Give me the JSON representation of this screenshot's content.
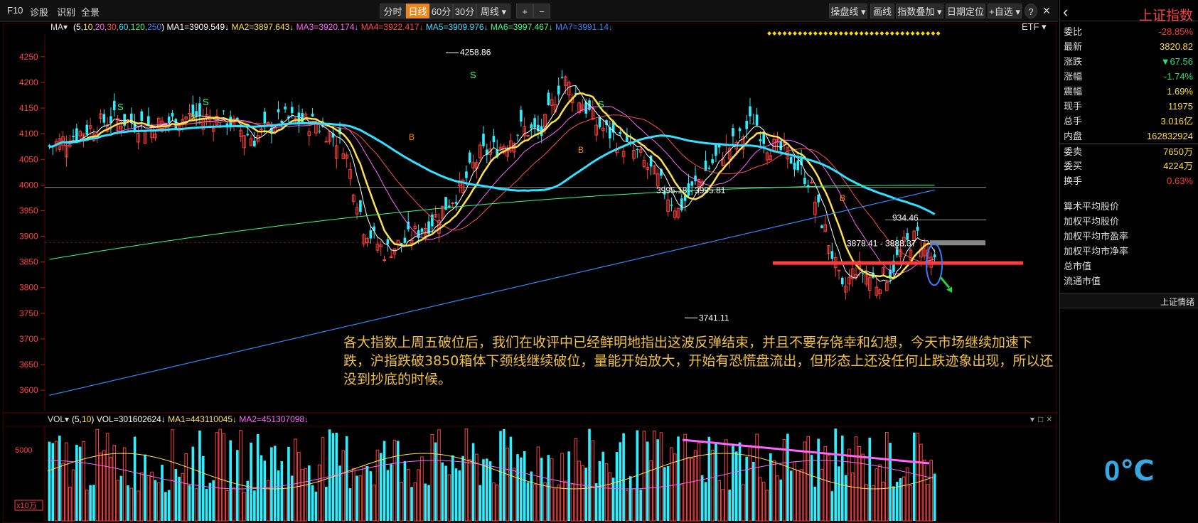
{
  "toolbar": {
    "left": [
      "F10",
      "诊股",
      "识别",
      "全景"
    ],
    "periods": [
      "分时",
      "日线",
      "60分",
      "30分",
      "周线 ▾"
    ],
    "active_period": "日线",
    "zoom": [
      "+",
      "−"
    ],
    "right": [
      "操盘线 ▾",
      "画线",
      "指数叠加 ▾",
      "日期定位",
      "+自选 ▾"
    ],
    "help": "?",
    "close": "×"
  },
  "ma_bar": {
    "label": "MA▾",
    "params_prefix": "(5,",
    "params": [
      {
        "text": "10,",
        "color": "#ffe14d"
      },
      {
        "text": "20,",
        "color": "#ff66ff"
      },
      {
        "text": "30,",
        "color": "#ff4d4d"
      },
      {
        "text": "60,",
        "color": "#33e0ff"
      },
      {
        "text": "120,",
        "color": "#33ff88"
      },
      {
        "text": "250",
        "color": "#3388ff"
      }
    ],
    "params_suffix": ")",
    "items": [
      {
        "text": "MA1=3909.549↓",
        "color": "#ffffff"
      },
      {
        "text": "MA2=3897.643↓",
        "color": "#ffe14d"
      },
      {
        "text": "MA3=3920.174↓",
        "color": "#ff66ff"
      },
      {
        "text": "MA4=3922.417↓",
        "color": "#ff4d4d"
      },
      {
        "text": "MA5=3909.976↓",
        "color": "#33e0ff"
      },
      {
        "text": "MA6=3997.467↓",
        "color": "#33ff88"
      },
      {
        "text": "MA7=3991.14↓",
        "color": "#3388ff"
      }
    ],
    "etf": "ETF ▾"
  },
  "price_axis": {
    "min": 3560,
    "max": 4290,
    "ticks": [
      4250,
      4200,
      4150,
      4100,
      4050,
      4000,
      3950,
      3900,
      3850,
      3800,
      3750,
      3700,
      3650,
      3600
    ]
  },
  "price_labels": {
    "high": "4258.86",
    "low": "3741.11",
    "range1": "3995.18 - 3995.81",
    "range2": "3878.41 - 3888.37",
    "partial": "934.46"
  },
  "signal_marks": {
    "s": "S",
    "b": "B"
  },
  "commentary": "各大指数上周五破位后，我们在收评中已经鲜明地指出这波反弹结束，并且不要存侥幸和幻想，今天市场继续加速下跌，沪指跌破3850箱体下颈线继续破位，量能开始放大，开始有恐慌盘流出，但形态上还没任何止跌迹象出现，所以还没到抄底的时候。",
  "vol_bar": {
    "label": "VOL▾",
    "params_prefix": "(5,",
    "params_mid": "10",
    "params_suffix": ")",
    "vol": "VOL=301602624↓",
    "ma1": "MA1=443110045↓",
    "ma2": "MA2=451307098↓"
  },
  "vol_axis": {
    "tick": "5000",
    "unit": "x10万"
  },
  "pane_controls": {
    "scroll": "▾",
    "max": "□",
    "close": "×"
  },
  "colors": {
    "up": "#ff4040",
    "down": "#2cf0ff",
    "ma10": "#ffe14d",
    "ma60": "#33e0ff",
    "ma120": "#33ff88",
    "ma250": "#3388ff",
    "ma20": "#ff66ff",
    "ma30": "#ff4d4d",
    "accent": "#e8871e"
  },
  "right_panel": {
    "back": "‹",
    "title": "上证指数",
    "rows": [
      {
        "k": "委比",
        "v": "-28.85%",
        "c": "red"
      },
      {
        "k": "最新",
        "v": "3820.82",
        "c": "yel"
      },
      {
        "k": "涨跌",
        "v": "▼67.56",
        "c": "grn"
      },
      {
        "k": "涨幅",
        "v": "-1.74%",
        "c": "grn"
      },
      {
        "k": "震幅",
        "v": "1.69%",
        "c": "yel"
      },
      {
        "k": "现手",
        "v": "11975",
        "c": "yel"
      },
      {
        "k": "总手",
        "v": "3.016亿",
        "c": "yel"
      },
      {
        "k": "内盘",
        "v": "162832924",
        "c": "yel"
      },
      {
        "k": "委卖",
        "v": "7650万",
        "c": "yel"
      },
      {
        "k": "委买",
        "v": "4224万",
        "c": "yel"
      },
      {
        "k": "换手",
        "v": "0.63%",
        "c": "red"
      }
    ],
    "labels": [
      "算术平均股价",
      "加权平均股价",
      "加权平均市盈率",
      "加权平均市净率",
      "总市值",
      "流通市值"
    ],
    "tab": "上证情绪",
    "temp": "0℃"
  }
}
